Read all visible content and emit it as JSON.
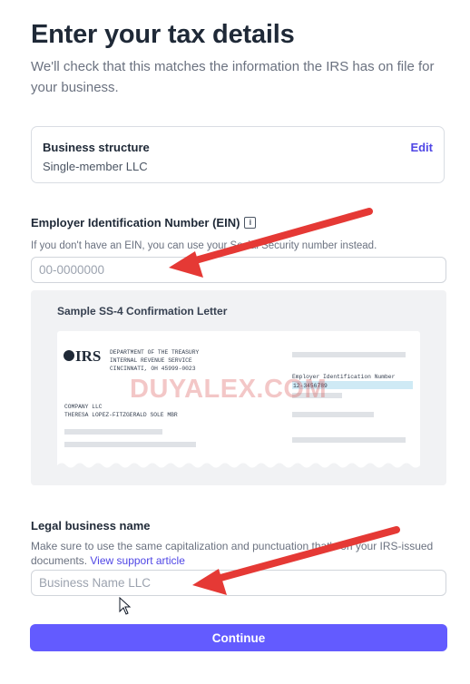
{
  "title": "Enter your tax details",
  "subtitle": "We'll check that this matches the information the IRS has on file for your business.",
  "business_structure": {
    "label": "Business structure",
    "value": "Single-member LLC",
    "edit_label": "Edit"
  },
  "ein": {
    "label": "Employer Identification Number (EIN)",
    "help": "If you don't have an EIN, you can use your Social Security number instead.",
    "placeholder": "00-0000000"
  },
  "sample_letter": {
    "title": "Sample SS-4 Confirmation Letter",
    "logo_text": "IRS",
    "dept_lines": [
      "DEPARTMENT OF THE TREASURY",
      "INTERNAL REVENUE SERVICE",
      "CINCINNATI, OH 45999-0023"
    ],
    "ein_heading": "Employer Identification Number",
    "ein_value": "12-3456789",
    "company_lines": [
      "COMPANY LLC",
      "THERESA LOPEZ-FITZGERALD SOLE MBR"
    ]
  },
  "legal_name": {
    "label": "Legal business name",
    "help": "Make sure to use the same capitalization and punctuation that's on your IRS-issued documents.",
    "support_link": "View support article",
    "placeholder": "Business Name LLC"
  },
  "continue_label": "Continue",
  "watermark": "DUYALEX.COM",
  "icons": {
    "info": "info-icon",
    "cursor": "mouse-cursor-icon",
    "arrow": "red-arrow-annotation"
  },
  "colors": {
    "accent": "#635bff",
    "link": "#4f46e5",
    "arrow": "#e53935"
  }
}
